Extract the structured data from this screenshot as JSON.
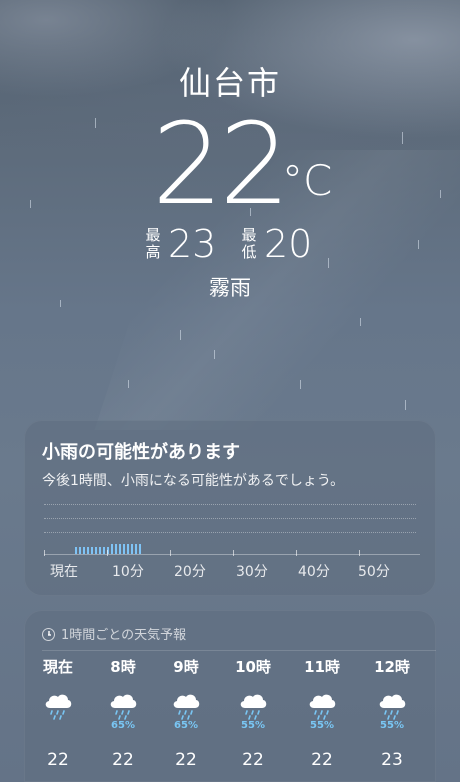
{
  "city": "仙台市",
  "current": {
    "temperature": "22",
    "unit": "°C",
    "high_label": "最高",
    "high": "23",
    "low_label": "最低",
    "low": "20",
    "condition": "霧雨"
  },
  "precip_card": {
    "title": "小雨の可能性があります",
    "subtitle": "今後1時間、小雨になる可能性があるでしょう。",
    "time_labels": [
      "現在",
      "10分",
      "20分",
      "30分",
      "40分",
      "50分"
    ]
  },
  "hourly_card": {
    "header": "1時間ごとの天気予報",
    "hours": [
      {
        "time": "現在",
        "icon": "rain-cloud-icon",
        "prob": "",
        "temp": "22"
      },
      {
        "time": "8時",
        "icon": "rain-cloud-icon",
        "prob": "65%",
        "temp": "22"
      },
      {
        "time": "9時",
        "icon": "rain-cloud-icon",
        "prob": "65%",
        "temp": "22"
      },
      {
        "time": "10時",
        "icon": "rain-cloud-icon",
        "prob": "55%",
        "temp": "22"
      },
      {
        "time": "11時",
        "icon": "rain-cloud-icon",
        "prob": "55%",
        "temp": "22"
      },
      {
        "time": "12時",
        "icon": "rain-cloud-icon",
        "prob": "55%",
        "temp": "23"
      }
    ]
  },
  "colors": {
    "accent_rain": "#79c6f4",
    "background_top": "#52606f",
    "background_bottom": "#647387"
  }
}
